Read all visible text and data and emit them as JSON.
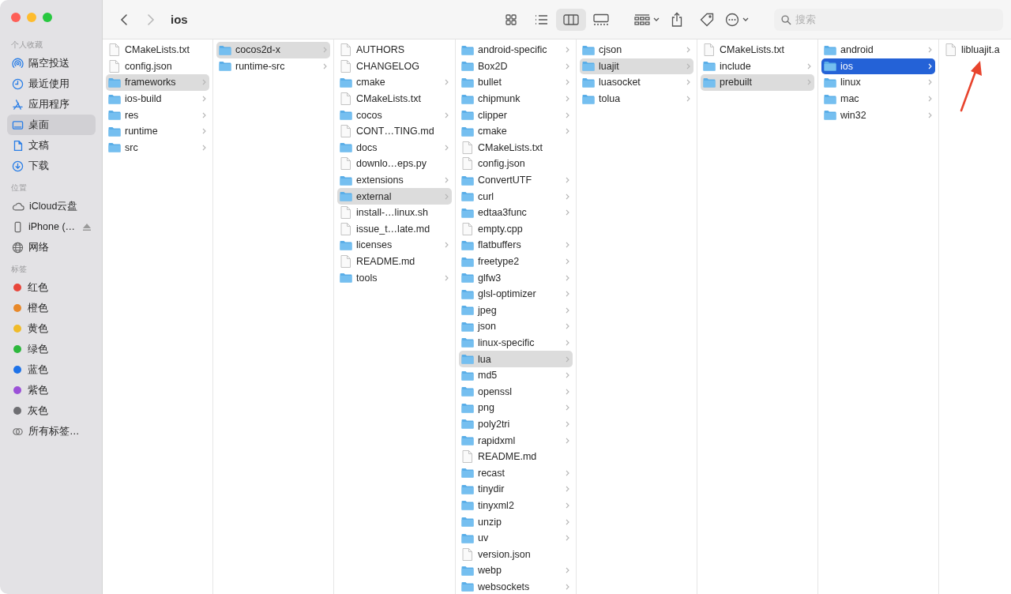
{
  "window": {
    "title": "ios"
  },
  "toolbar": {
    "views": [
      {
        "kind": "icons",
        "selected": false
      },
      {
        "kind": "list",
        "selected": false
      },
      {
        "kind": "columns",
        "selected": true
      },
      {
        "kind": "gallery",
        "selected": false
      }
    ],
    "search": {
      "placeholder": "搜索"
    }
  },
  "sidebar": {
    "sections": [
      {
        "title": "个人收藏",
        "items": [
          {
            "kind": "airdrop",
            "label": "隔空投送",
            "selected": false
          },
          {
            "kind": "recent",
            "label": "最近使用",
            "selected": false
          },
          {
            "kind": "apps",
            "label": "应用程序",
            "selected": false
          },
          {
            "kind": "desktop",
            "label": "桌面",
            "selected": true
          },
          {
            "kind": "documents",
            "label": "文稿",
            "selected": false
          },
          {
            "kind": "downloads",
            "label": "下载",
            "selected": false
          }
        ]
      },
      {
        "title": "位置",
        "items": [
          {
            "kind": "cloud",
            "label": "iCloud云盘",
            "selected": false
          },
          {
            "kind": "device",
            "label": "iPhone (…",
            "selected": false,
            "ejectable": true
          },
          {
            "kind": "network",
            "label": "网络",
            "selected": false
          }
        ]
      },
      {
        "title": "标签",
        "items": [
          {
            "kind": "tag",
            "label": "红色",
            "color": "#e8463b",
            "selected": false
          },
          {
            "kind": "tag",
            "label": "橙色",
            "color": "#e8892a",
            "selected": false
          },
          {
            "kind": "tag",
            "label": "黄色",
            "color": "#f0bb2a",
            "selected": false
          },
          {
            "kind": "tag",
            "label": "绿色",
            "color": "#2db83d",
            "selected": false
          },
          {
            "kind": "tag",
            "label": "蓝色",
            "color": "#1e72e8",
            "selected": false
          },
          {
            "kind": "tag",
            "label": "紫色",
            "color": "#9b51d8",
            "selected": false
          },
          {
            "kind": "tag",
            "label": "灰色",
            "color": "#6e6e72",
            "selected": false
          },
          {
            "kind": "all-tags",
            "label": "所有标签…",
            "selected": false
          }
        ]
      }
    ]
  },
  "columns": [
    {
      "focused": false,
      "items": [
        {
          "kind": "file",
          "name": "CMakeLists.txt",
          "selected": false
        },
        {
          "kind": "file",
          "name": "config.json",
          "selected": false
        },
        {
          "kind": "folder",
          "name": "frameworks",
          "selected": true
        },
        {
          "kind": "folder",
          "name": "ios-build",
          "selected": false
        },
        {
          "kind": "folder",
          "name": "res",
          "selected": false
        },
        {
          "kind": "folder",
          "name": "runtime",
          "selected": false
        },
        {
          "kind": "folder",
          "name": "src",
          "selected": false
        }
      ]
    },
    {
      "focused": false,
      "items": [
        {
          "kind": "folder",
          "name": "cocos2d-x",
          "selected": true
        },
        {
          "kind": "folder",
          "name": "runtime-src",
          "selected": false
        }
      ]
    },
    {
      "focused": false,
      "items": [
        {
          "kind": "file",
          "name": "AUTHORS",
          "selected": false
        },
        {
          "kind": "file",
          "name": "CHANGELOG",
          "selected": false
        },
        {
          "kind": "folder",
          "name": "cmake",
          "selected": false
        },
        {
          "kind": "file",
          "name": "CMakeLists.txt",
          "selected": false
        },
        {
          "kind": "folder",
          "name": "cocos",
          "selected": false
        },
        {
          "kind": "file",
          "name": "CONT…TING.md",
          "selected": false
        },
        {
          "kind": "folder",
          "name": "docs",
          "selected": false
        },
        {
          "kind": "file",
          "name": "downlo…eps.py",
          "selected": false
        },
        {
          "kind": "folder",
          "name": "extensions",
          "selected": false
        },
        {
          "kind": "folder",
          "name": "external",
          "selected": true
        },
        {
          "kind": "file",
          "name": "install-…linux.sh",
          "selected": false
        },
        {
          "kind": "file",
          "name": "issue_t…late.md",
          "selected": false
        },
        {
          "kind": "folder",
          "name": "licenses",
          "selected": false
        },
        {
          "kind": "file",
          "name": "README.md",
          "selected": false
        },
        {
          "kind": "folder",
          "name": "tools",
          "selected": false
        }
      ]
    },
    {
      "focused": false,
      "items": [
        {
          "kind": "folder",
          "name": "android-specific",
          "selected": false
        },
        {
          "kind": "folder",
          "name": "Box2D",
          "selected": false
        },
        {
          "kind": "folder",
          "name": "bullet",
          "selected": false
        },
        {
          "kind": "folder",
          "name": "chipmunk",
          "selected": false
        },
        {
          "kind": "folder",
          "name": "clipper",
          "selected": false
        },
        {
          "kind": "folder",
          "name": "cmake",
          "selected": false
        },
        {
          "kind": "file",
          "name": "CMakeLists.txt",
          "selected": false
        },
        {
          "kind": "file",
          "name": "config.json",
          "selected": false
        },
        {
          "kind": "folder",
          "name": "ConvertUTF",
          "selected": false
        },
        {
          "kind": "folder",
          "name": "curl",
          "selected": false
        },
        {
          "kind": "folder",
          "name": "edtaa3func",
          "selected": false
        },
        {
          "kind": "file",
          "name": "empty.cpp",
          "selected": false
        },
        {
          "kind": "folder",
          "name": "flatbuffers",
          "selected": false
        },
        {
          "kind": "folder",
          "name": "freetype2",
          "selected": false
        },
        {
          "kind": "folder",
          "name": "glfw3",
          "selected": false
        },
        {
          "kind": "folder",
          "name": "glsl-optimizer",
          "selected": false
        },
        {
          "kind": "folder",
          "name": "jpeg",
          "selected": false
        },
        {
          "kind": "folder",
          "name": "json",
          "selected": false
        },
        {
          "kind": "folder",
          "name": "linux-specific",
          "selected": false
        },
        {
          "kind": "folder",
          "name": "lua",
          "selected": true
        },
        {
          "kind": "folder",
          "name": "md5",
          "selected": false
        },
        {
          "kind": "folder",
          "name": "openssl",
          "selected": false
        },
        {
          "kind": "folder",
          "name": "png",
          "selected": false
        },
        {
          "kind": "folder",
          "name": "poly2tri",
          "selected": false
        },
        {
          "kind": "folder",
          "name": "rapidxml",
          "selected": false
        },
        {
          "kind": "file",
          "name": "README.md",
          "selected": false
        },
        {
          "kind": "folder",
          "name": "recast",
          "selected": false
        },
        {
          "kind": "folder",
          "name": "tinydir",
          "selected": false
        },
        {
          "kind": "folder",
          "name": "tinyxml2",
          "selected": false
        },
        {
          "kind": "folder",
          "name": "unzip",
          "selected": false
        },
        {
          "kind": "folder",
          "name": "uv",
          "selected": false
        },
        {
          "kind": "file",
          "name": "version.json",
          "selected": false
        },
        {
          "kind": "folder",
          "name": "webp",
          "selected": false
        },
        {
          "kind": "folder",
          "name": "websockets",
          "selected": false
        }
      ]
    },
    {
      "focused": false,
      "items": [
        {
          "kind": "folder",
          "name": "cjson",
          "selected": false
        },
        {
          "kind": "folder",
          "name": "luajit",
          "selected": true
        },
        {
          "kind": "folder",
          "name": "luasocket",
          "selected": false
        },
        {
          "kind": "folder",
          "name": "tolua",
          "selected": false
        }
      ]
    },
    {
      "focused": false,
      "items": [
        {
          "kind": "file",
          "name": "CMakeLists.txt",
          "selected": false
        },
        {
          "kind": "folder",
          "name": "include",
          "selected": false
        },
        {
          "kind": "folder",
          "name": "prebuilt",
          "selected": true
        }
      ]
    },
    {
      "focused": true,
      "items": [
        {
          "kind": "folder",
          "name": "android",
          "selected": false
        },
        {
          "kind": "folder",
          "name": "ios",
          "selected": true
        },
        {
          "kind": "folder",
          "name": "linux",
          "selected": false
        },
        {
          "kind": "folder",
          "name": "mac",
          "selected": false
        },
        {
          "kind": "folder",
          "name": "win32",
          "selected": false
        }
      ]
    },
    {
      "items": [
        {
          "kind": "file",
          "name": "libluajit.a",
          "selected": false
        }
      ]
    }
  ]
}
